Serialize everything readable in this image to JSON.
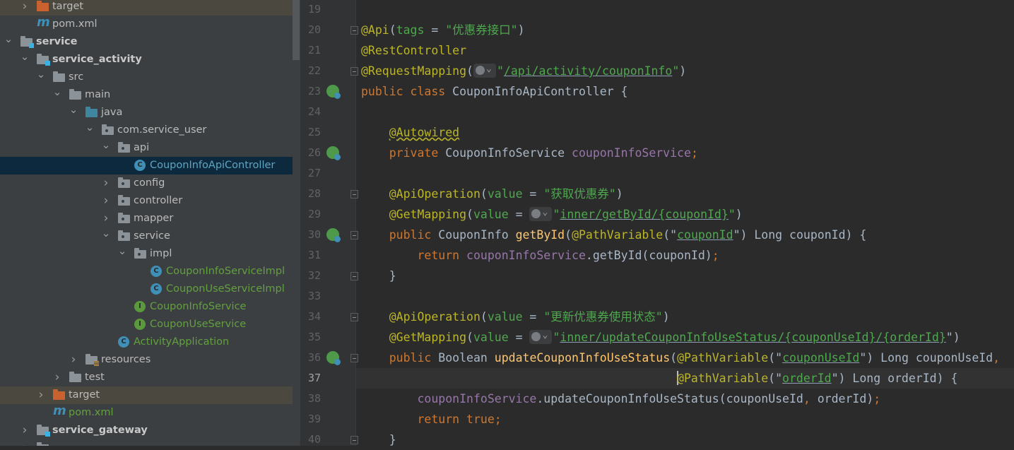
{
  "colors": {
    "keyword": "#cc7832",
    "annotation": "#bbb529",
    "string": "#4ea84e",
    "field": "#9876aa",
    "method": "#ffc66d",
    "text": "#a9b7c6",
    "selection": "#0d293e"
  },
  "tree": [
    {
      "label": "target",
      "level": 1,
      "arrow": "closed",
      "icon": "folder-orange",
      "style": "hl"
    },
    {
      "label": "pom.xml",
      "level": 1,
      "arrow": "none",
      "icon": "maven",
      "style": ""
    },
    {
      "label": "service",
      "level": 0,
      "arrow": "open",
      "icon": "folder-module",
      "style": "bold"
    },
    {
      "label": "service_activity",
      "level": 1,
      "arrow": "open",
      "icon": "folder-module",
      "style": "bold"
    },
    {
      "label": "src",
      "level": 2,
      "arrow": "open",
      "icon": "folder",
      "style": ""
    },
    {
      "label": "main",
      "level": 3,
      "arrow": "open",
      "icon": "folder",
      "style": ""
    },
    {
      "label": "java",
      "level": 4,
      "arrow": "open",
      "icon": "folder-blue",
      "style": ""
    },
    {
      "label": "com.service_user",
      "level": 5,
      "arrow": "open",
      "icon": "package",
      "style": ""
    },
    {
      "label": "api",
      "level": 6,
      "arrow": "open",
      "icon": "package",
      "style": ""
    },
    {
      "label": "CouponInfoApiController",
      "level": 7,
      "arrow": "none",
      "icon": "class",
      "style": "sel"
    },
    {
      "label": "config",
      "level": 6,
      "arrow": "closed",
      "icon": "package",
      "style": ""
    },
    {
      "label": "controller",
      "level": 6,
      "arrow": "closed",
      "icon": "package",
      "style": ""
    },
    {
      "label": "mapper",
      "level": 6,
      "arrow": "closed",
      "icon": "package",
      "style": ""
    },
    {
      "label": "service",
      "level": 6,
      "arrow": "open",
      "icon": "package",
      "style": ""
    },
    {
      "label": "impl",
      "level": 7,
      "arrow": "open",
      "icon": "package",
      "style": ""
    },
    {
      "label": "CouponInfoServiceImpl",
      "level": 8,
      "arrow": "none",
      "icon": "class",
      "style": "green"
    },
    {
      "label": "CouponUseServiceImpl",
      "level": 8,
      "arrow": "none",
      "icon": "class",
      "style": "green"
    },
    {
      "label": "CouponInfoService",
      "level": 7,
      "arrow": "none",
      "icon": "interface",
      "style": "green"
    },
    {
      "label": "CouponUseService",
      "level": 7,
      "arrow": "none",
      "icon": "interface",
      "style": "green"
    },
    {
      "label": "ActivityApplication",
      "level": 6,
      "arrow": "none",
      "icon": "spring-boot-class",
      "style": "green"
    },
    {
      "label": "resources",
      "level": 4,
      "arrow": "closed",
      "icon": "folder-resources",
      "style": ""
    },
    {
      "label": "test",
      "level": 3,
      "arrow": "closed",
      "icon": "folder",
      "style": ""
    },
    {
      "label": "target",
      "level": 2,
      "arrow": "closed",
      "icon": "folder-orange",
      "style": "hl"
    },
    {
      "label": "pom.xml",
      "level": 2,
      "arrow": "none",
      "icon": "maven",
      "style": "green"
    },
    {
      "label": "service_gateway",
      "level": 1,
      "arrow": "closed",
      "icon": "folder-module",
      "style": "bold"
    },
    {
      "label": "",
      "level": 1,
      "arrow": "closed",
      "icon": "folder-module",
      "style": "bold"
    }
  ],
  "editor": {
    "current_line": 37,
    "lines": [
      {
        "n": 19,
        "t": []
      },
      {
        "n": 20,
        "fold": true,
        "t": [
          [
            "an",
            "@Api"
          ],
          [
            "",
            "("
          ],
          [
            "pm",
            "tags"
          ],
          [
            "",
            " = "
          ],
          [
            "st",
            "\"优惠券接口\""
          ],
          [
            "",
            ")"
          ]
        ]
      },
      {
        "n": 21,
        "t": [
          [
            "an",
            "@RestController"
          ]
        ]
      },
      {
        "n": 22,
        "fold": true,
        "t": [
          [
            "an",
            "@RequestMapping"
          ],
          [
            "",
            "("
          ],
          [
            "inlay",
            ""
          ],
          [
            "st",
            "\""
          ],
          [
            "st ul",
            "/api/activity/couponInfo"
          ],
          [
            "st",
            "\""
          ],
          [
            "",
            ")"
          ]
        ]
      },
      {
        "n": 23,
        "gutter": "bean",
        "t": [
          [
            "kw",
            "public class "
          ],
          [
            "",
            "CouponInfoApiController {"
          ]
        ]
      },
      {
        "n": 24,
        "t": []
      },
      {
        "n": 25,
        "t": [
          [
            "",
            "    "
          ],
          [
            "an sq",
            "@Autowired"
          ]
        ]
      },
      {
        "n": 26,
        "gutter": "bean",
        "t": [
          [
            "",
            "    "
          ],
          [
            "kw",
            "private "
          ],
          [
            "",
            "CouponInfoService "
          ],
          [
            "fd",
            "couponInfoService"
          ],
          [
            "kw",
            ";"
          ]
        ]
      },
      {
        "n": 27,
        "t": []
      },
      {
        "n": 28,
        "fold": true,
        "t": [
          [
            "",
            "    "
          ],
          [
            "an",
            "@ApiOperation"
          ],
          [
            "",
            "("
          ],
          [
            "pm",
            "value"
          ],
          [
            "",
            " = "
          ],
          [
            "st",
            "\"获取优惠券\""
          ],
          [
            "",
            ")"
          ]
        ]
      },
      {
        "n": 29,
        "t": [
          [
            "",
            "    "
          ],
          [
            "an",
            "@GetMapping"
          ],
          [
            "",
            "("
          ],
          [
            "pm",
            "value"
          ],
          [
            "",
            " = "
          ],
          [
            "inlay",
            ""
          ],
          [
            "st",
            "\""
          ],
          [
            "st ul",
            "inner/getById/{couponId}"
          ],
          [
            "st",
            "\""
          ],
          [
            "",
            ")"
          ]
        ]
      },
      {
        "n": 30,
        "gutter": "web",
        "fold": true,
        "t": [
          [
            "",
            "    "
          ],
          [
            "kw",
            "public "
          ],
          [
            "",
            "CouponInfo "
          ],
          [
            "mt",
            "getById"
          ],
          [
            "",
            "("
          ],
          [
            "an",
            "@PathVariable"
          ],
          [
            "",
            "(\""
          ],
          [
            "st ul",
            "couponId"
          ],
          [
            "",
            "\") Long couponId) {"
          ]
        ]
      },
      {
        "n": 31,
        "t": [
          [
            "",
            "        "
          ],
          [
            "kw",
            "return "
          ],
          [
            "fd",
            "couponInfoService"
          ],
          [
            "",
            ".getById(couponId)"
          ],
          [
            "kw",
            ";"
          ]
        ]
      },
      {
        "n": 32,
        "fold": true,
        "t": [
          [
            "",
            "    }"
          ]
        ]
      },
      {
        "n": 33,
        "t": []
      },
      {
        "n": 34,
        "fold": true,
        "t": [
          [
            "",
            "    "
          ],
          [
            "an",
            "@ApiOperation"
          ],
          [
            "",
            "("
          ],
          [
            "pm",
            "value"
          ],
          [
            "",
            " = "
          ],
          [
            "st",
            "\"更新优惠券使用状态\""
          ],
          [
            "",
            ")"
          ]
        ]
      },
      {
        "n": 35,
        "t": [
          [
            "",
            "    "
          ],
          [
            "an",
            "@GetMapping"
          ],
          [
            "",
            "("
          ],
          [
            "pm",
            "value"
          ],
          [
            "",
            " = "
          ],
          [
            "inlay",
            ""
          ],
          [
            "st",
            "\""
          ],
          [
            "st ul",
            "inner/updateCouponInfoUseStatus/{couponUseId}/{orderId}"
          ],
          [
            "",
            "\")"
          ]
        ]
      },
      {
        "n": 36,
        "gutter": "web",
        "fold": true,
        "t": [
          [
            "",
            "    "
          ],
          [
            "kw",
            "public "
          ],
          [
            "",
            "Boolean "
          ],
          [
            "mt",
            "updateCouponInfoUseStatus"
          ],
          [
            "",
            "("
          ],
          [
            "an",
            "@PathVariable"
          ],
          [
            "",
            "(\""
          ],
          [
            "st ul",
            "couponUseId"
          ],
          [
            "",
            "\") Long couponUseId"
          ],
          [
            "kw",
            ","
          ]
        ]
      },
      {
        "n": 37,
        "t": [
          [
            "",
            "                                             "
          ],
          [
            "caret",
            ""
          ],
          [
            "an",
            "@PathVariable"
          ],
          [
            "",
            "(\""
          ],
          [
            "st ul",
            "orderId"
          ],
          [
            "",
            "\") Long orderId) {"
          ]
        ]
      },
      {
        "n": 38,
        "t": [
          [
            "",
            "        "
          ],
          [
            "fd",
            "couponInfoService"
          ],
          [
            "",
            ".updateCouponInfoUseStatus(couponUseId"
          ],
          [
            "kw",
            ","
          ],
          [
            "",
            " orderId)"
          ],
          [
            "kw",
            ";"
          ]
        ]
      },
      {
        "n": 39,
        "t": [
          [
            "",
            "        "
          ],
          [
            "kw",
            "return true;"
          ]
        ]
      },
      {
        "n": 40,
        "fold": true,
        "t": [
          [
            "",
            "    }"
          ]
        ]
      }
    ]
  }
}
